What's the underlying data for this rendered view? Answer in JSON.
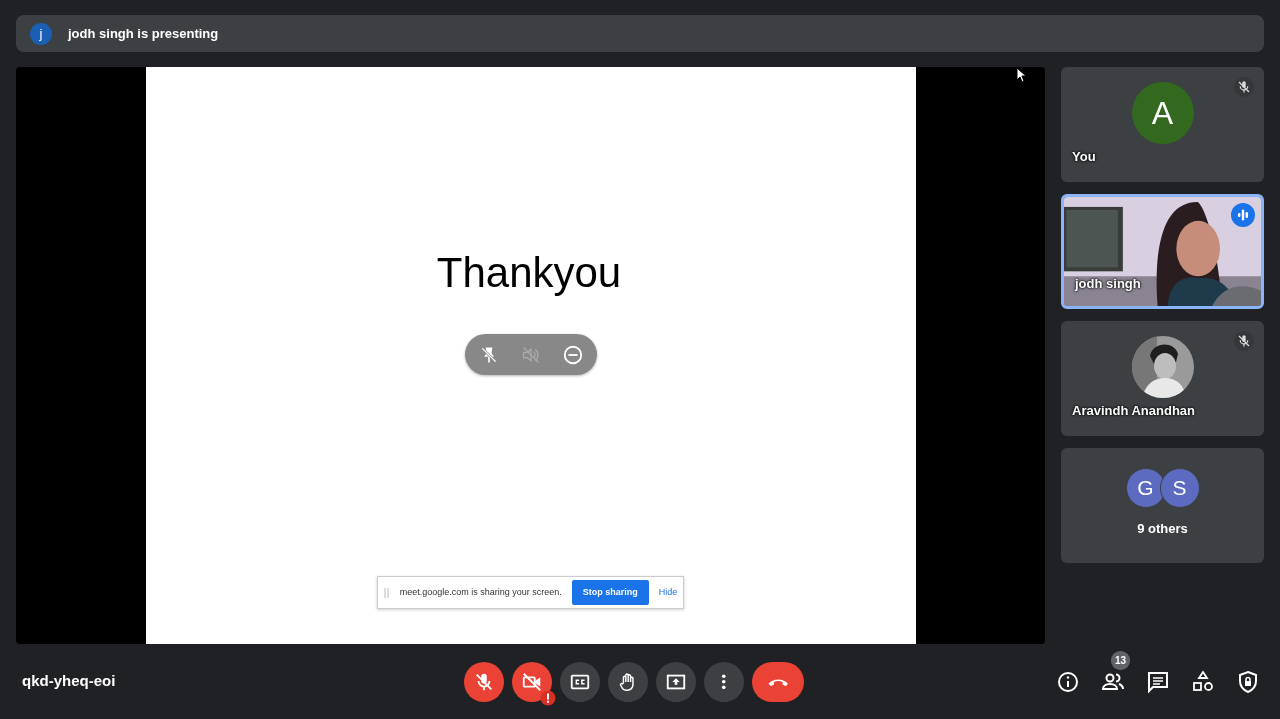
{
  "presenter_banner": {
    "avatar_letter": "j",
    "text": "jodh singh is presenting"
  },
  "slide": {
    "title": "Thankyou",
    "overlay_buttons": [
      {
        "kind": "unpin",
        "disabled": false
      },
      {
        "kind": "mute",
        "disabled": true
      },
      {
        "kind": "remove",
        "disabled": false
      }
    ],
    "share_bar": {
      "message": "meet.google.com is sharing your screen.",
      "stop_button": "Stop sharing",
      "hide_link": "Hide"
    }
  },
  "tiles": [
    {
      "kind": "avatar",
      "name": "You",
      "letter": "A",
      "color": "#33691e",
      "muted": true,
      "speaking": false
    },
    {
      "kind": "video",
      "name": "jodh singh",
      "muted": false,
      "speaking": true
    },
    {
      "name": "Aravindh Anandhan",
      "muted": true,
      "speaking": false
    },
    {
      "kind": "group",
      "letters": [
        "G",
        "S"
      ],
      "label": "9 others"
    }
  ],
  "meeting_code": "qkd-yheq-eoi",
  "controls": [
    {
      "kind": "mic",
      "off": true
    },
    {
      "kind": "camera",
      "off": true,
      "warning": true
    },
    {
      "kind": "captions",
      "on": false
    },
    {
      "kind": "hand",
      "on": false
    },
    {
      "kind": "present",
      "on": false
    },
    {
      "kind": "more"
    },
    {
      "kind": "leave"
    }
  ],
  "side_buttons": [
    {
      "kind": "info"
    },
    {
      "kind": "people",
      "badge": "13"
    },
    {
      "kind": "chat"
    },
    {
      "kind": "activities"
    },
    {
      "kind": "host-controls"
    }
  ]
}
